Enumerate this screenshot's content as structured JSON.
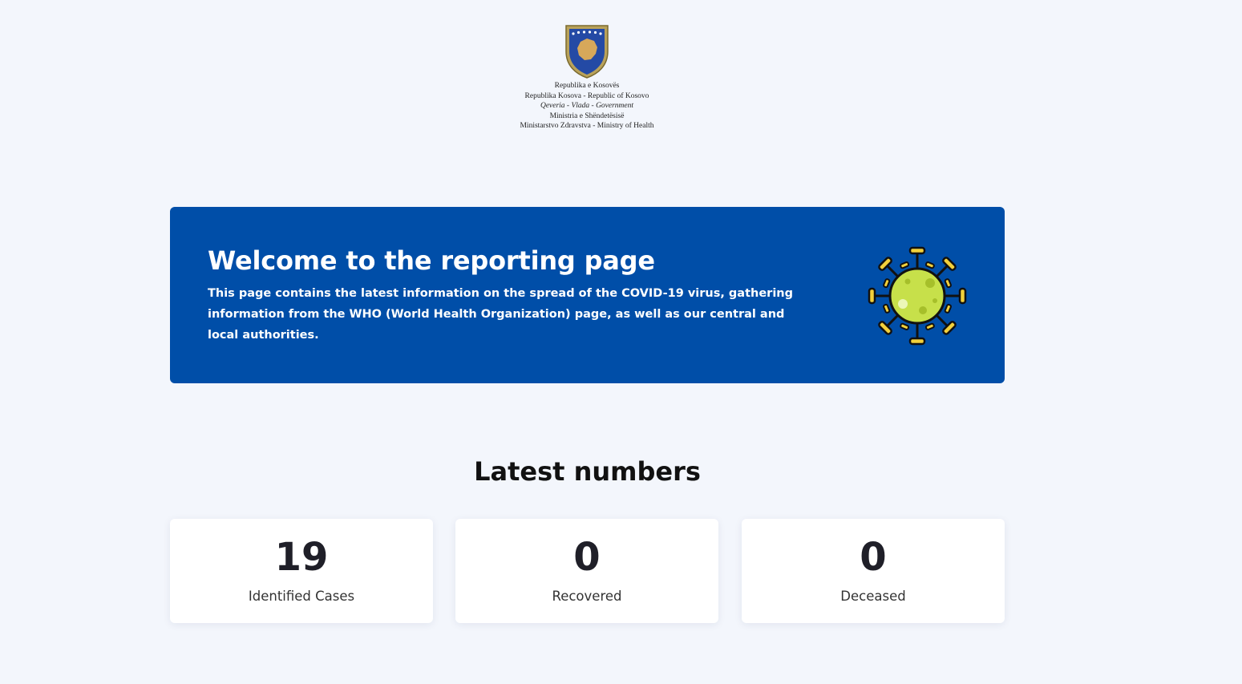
{
  "header": {
    "logo_icon": "kosovo-coat-of-arms-icon",
    "lines": [
      "Republika e Kosovës",
      "Republika Kosova - Republic of Kosovo",
      "Qeveria - Vlada - Government",
      "Ministria e Shëndetësisë",
      "Ministarstvo Zdravstva - Ministry of Health"
    ]
  },
  "banner": {
    "title": "Welcome to the reporting page",
    "text": "This page contains the latest information on the spread of the COVID-19 virus, gathering information from the WHO (World Health Organization) page, as well as our central and local authorities.",
    "icon": "virus-icon",
    "background_color": "#004ea8"
  },
  "latest": {
    "title": "Latest numbers",
    "stats": [
      {
        "value": "19",
        "label": "Identified Cases"
      },
      {
        "value": "0",
        "label": "Recovered"
      },
      {
        "value": "0",
        "label": "Deceased"
      }
    ]
  },
  "colors": {
    "page_background": "#f3f6fc",
    "virus_fill": "#c7e04a",
    "virus_spikes": "#f2d03b"
  }
}
